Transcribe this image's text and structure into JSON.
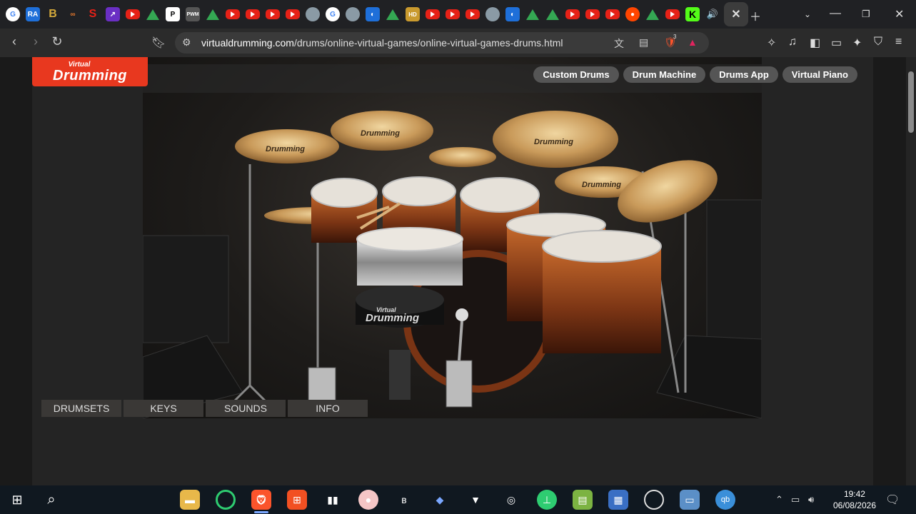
{
  "browser": {
    "url_domain": "virtualdrumming.com",
    "url_path": "/drums/online-virtual-games/online-virtual-games-drums.html",
    "shield_badge": "3"
  },
  "site": {
    "logo_line1": "Virtual",
    "logo_line2": "Drumming",
    "nav": [
      "Custom Drums",
      "Drum Machine",
      "Drums App",
      "Virtual Piano"
    ],
    "tabs": [
      "DRUMSETS",
      "KEYS",
      "SOUNDS",
      "INFO"
    ],
    "throne_text_line1": "Virtual",
    "throne_text_line2": "Drumming",
    "cymbal_brand": "Drumming"
  },
  "taskbar": {
    "time": "19:42",
    "date": "06/08/2026"
  }
}
